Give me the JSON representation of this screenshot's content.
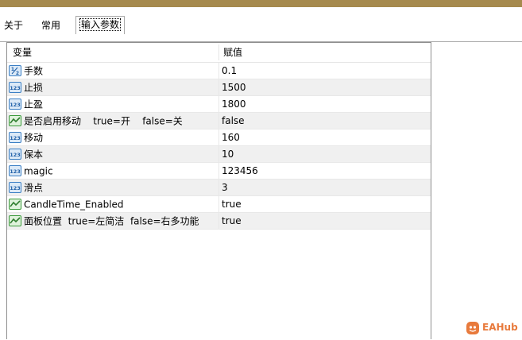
{
  "tabs": [
    {
      "label": "关于"
    },
    {
      "label": "常用"
    },
    {
      "label": "输入参数"
    }
  ],
  "table": {
    "headers": {
      "variable": "变量",
      "value": "赋值"
    },
    "rows": [
      {
        "icon": "fraction-icon",
        "name": "手数",
        "value": "0.1"
      },
      {
        "icon": "integer-icon",
        "name": "止损",
        "value": "1500"
      },
      {
        "icon": "integer-icon",
        "name": "止盈",
        "value": "1800"
      },
      {
        "icon": "boolean-icon",
        "name": "是否启用移动    true=开    false=关",
        "value": "false"
      },
      {
        "icon": "integer-icon",
        "name": "移动",
        "value": "160"
      },
      {
        "icon": "integer-icon",
        "name": "保本",
        "value": "10"
      },
      {
        "icon": "integer-icon",
        "name": "magic",
        "value": "123456"
      },
      {
        "icon": "integer-icon",
        "name": "滑点",
        "value": "3"
      },
      {
        "icon": "boolean-icon",
        "name": "CandleTime_Enabled",
        "value": "true"
      },
      {
        "icon": "boolean-icon",
        "name": "面板位置  true=左简洁  false=右多功能",
        "value": "true"
      }
    ]
  },
  "watermark": {
    "text": "EAHub"
  },
  "colors": {
    "titlebar": "#a68a4e",
    "watermark": "#e87a3c",
    "integer_icon": "#3b7fc4",
    "boolean_icon": "#3a9a3a"
  }
}
